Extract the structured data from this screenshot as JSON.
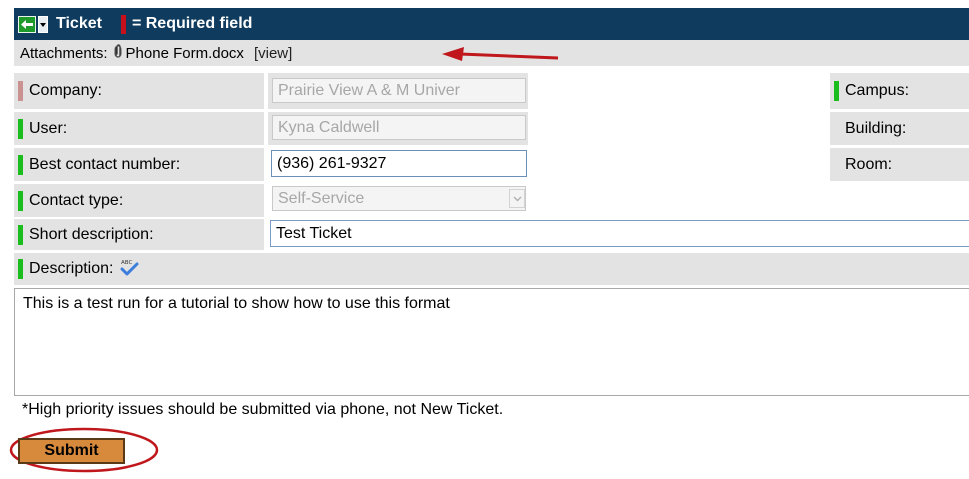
{
  "header": {
    "title": "Ticket",
    "required_text": "= Required field"
  },
  "attachments": {
    "label": "Attachments:",
    "file_name": "Phone Form.docx",
    "view_label": "[view]"
  },
  "form": {
    "company": {
      "label": "Company:",
      "value": "Prairie View A & M Univer"
    },
    "user": {
      "label": "User:",
      "value": "Kyna Caldwell"
    },
    "best_contact": {
      "label": "Best contact number:",
      "value": "(936) 261-9327"
    },
    "contact_type": {
      "label": "Contact type:",
      "value": "Self-Service"
    },
    "short_description": {
      "label": "Short description:",
      "value": "Test Ticket"
    },
    "description": {
      "label": "Description:",
      "value": "This is a test run for a tutorial to show how to use this format"
    },
    "campus": {
      "label": "Campus:"
    },
    "building": {
      "label": "Building:"
    },
    "room": {
      "label": "Room:"
    }
  },
  "note": "*High priority issues should be submitted via phone, not New Ticket.",
  "submit_label": "Submit",
  "colors": {
    "header_bg": "#0f3c5e",
    "required_marker": "#c8101b",
    "mandatory_marker": "#19bd1d",
    "filled_marker": "#c9918f",
    "submit_bg": "#d88a3c",
    "annotation_red": "#c0171c"
  },
  "icons": {
    "back": "back-arrow-icon",
    "menu": "dropdown-menu-icon",
    "attachment": "paperclip-icon",
    "spellcheck": "spellcheck-icon",
    "select": "chevron-down-icon"
  }
}
